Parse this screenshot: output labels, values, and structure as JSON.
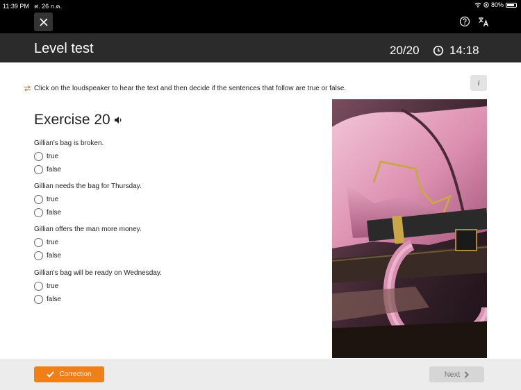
{
  "status_bar": {
    "time": "11:39 PM",
    "date": "ศ. 26 ก.ค.",
    "battery": "80%",
    "battery_level": 0.8
  },
  "header": {
    "title": "Level test",
    "progress": "20/20",
    "timer": "14:18"
  },
  "instructions": "Click on the loudspeaker to hear the text and then decide if the sentences that follow are true or false.",
  "info_label": "i",
  "exercise": {
    "title": "Exercise 20",
    "questions": [
      {
        "text": "Gillian's bag is broken.",
        "options": [
          "true",
          "false"
        ]
      },
      {
        "text": "Gillian needs the bag for Thursday.",
        "options": [
          "true",
          "false"
        ]
      },
      {
        "text": "Gillian offers the man more money.",
        "options": [
          "true",
          "false"
        ]
      },
      {
        "text": "Gillian's bag will be ready on Wednesday.",
        "options": [
          "true",
          "false"
        ]
      }
    ]
  },
  "footer": {
    "correction_label": "Correction",
    "next_label": "Next"
  },
  "colors": {
    "accent": "#f07f17",
    "header_bg": "#2b2b2b",
    "topbar_bg": "#000000"
  },
  "icons": [
    "close-icon",
    "help-icon",
    "translate-icon",
    "timer-icon",
    "speaker-icon",
    "swap-icon",
    "check-icon",
    "chevron-right-icon"
  ]
}
